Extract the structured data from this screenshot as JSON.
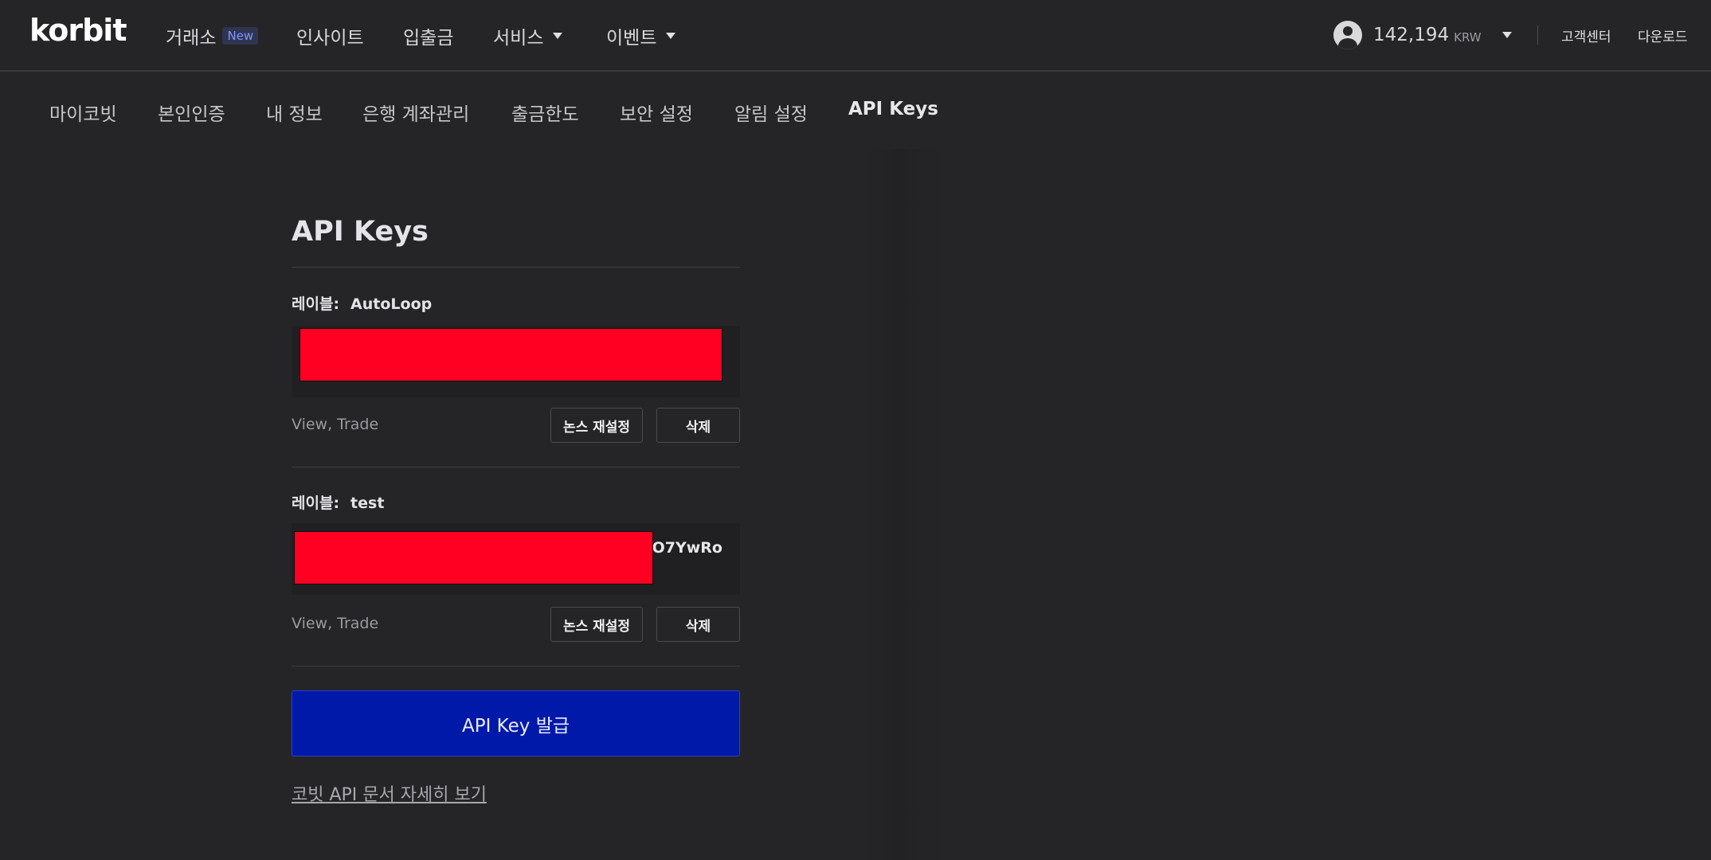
{
  "header": {
    "logo": "korbit",
    "nav": [
      {
        "label": "거래소",
        "badge": "New"
      },
      {
        "label": "인사이트"
      },
      {
        "label": "입출금"
      },
      {
        "label": "서비스"
      },
      {
        "label": "이벤트"
      }
    ],
    "balance": "142,194",
    "currency": "KRW",
    "support": "고객센터",
    "download": "다운로드"
  },
  "subnav": {
    "items": [
      "마이코빗",
      "본인인증",
      "내 정보",
      "은행 계좌관리",
      "출금한도",
      "보안 설정",
      "알림 설정",
      "API Keys"
    ],
    "active": "API Keys"
  },
  "main": {
    "title": "API Keys",
    "label_prefix": "레이블:",
    "keys": [
      {
        "label": "AutoLoop",
        "key_visible": "",
        "permissions": "View, Trade",
        "reset_button": "논스 재설정",
        "delete_button": "삭제"
      },
      {
        "label": "test",
        "key_visible": "aO7YwRo",
        "permissions": "View, Trade",
        "reset_button": "논스 재설정",
        "delete_button": "삭제"
      }
    ],
    "issue_button": "API Key 발급",
    "docs_link": "코빗 API 문서 자세히 보기"
  },
  "colors": {
    "background": "#252527",
    "primary_button": "#0019a8",
    "redaction": "#ff0022",
    "badge_text": "#7f97ff"
  }
}
